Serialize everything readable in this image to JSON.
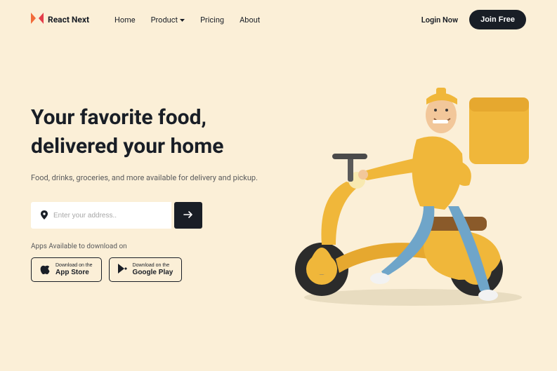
{
  "brand": {
    "name": "React Next"
  },
  "nav": {
    "items": [
      {
        "label": "Home"
      },
      {
        "label": "Product",
        "dropdown": true
      },
      {
        "label": "Pricing"
      },
      {
        "label": "About"
      }
    ]
  },
  "auth": {
    "login": "Login Now",
    "join": "Join Free"
  },
  "hero": {
    "headline_line1": "Your favorite food,",
    "headline_line2": "delivered your home",
    "subtext": "Food, drinks, groceries, and more available for delivery and pickup."
  },
  "search": {
    "placeholder": "Enter your address..",
    "value": ""
  },
  "apps": {
    "label": "Apps Available to download on",
    "buttons": [
      {
        "small": "Download on the",
        "big": "App Store",
        "icon": "apple"
      },
      {
        "small": "Download on the",
        "big": "Google Play",
        "icon": "play"
      }
    ]
  },
  "colors": {
    "bg": "#fbefd7",
    "dark": "#191e26",
    "accent_yellow": "#f0b73a",
    "accent_orange": "#f26b3a",
    "accent_red": "#e43d4a"
  }
}
